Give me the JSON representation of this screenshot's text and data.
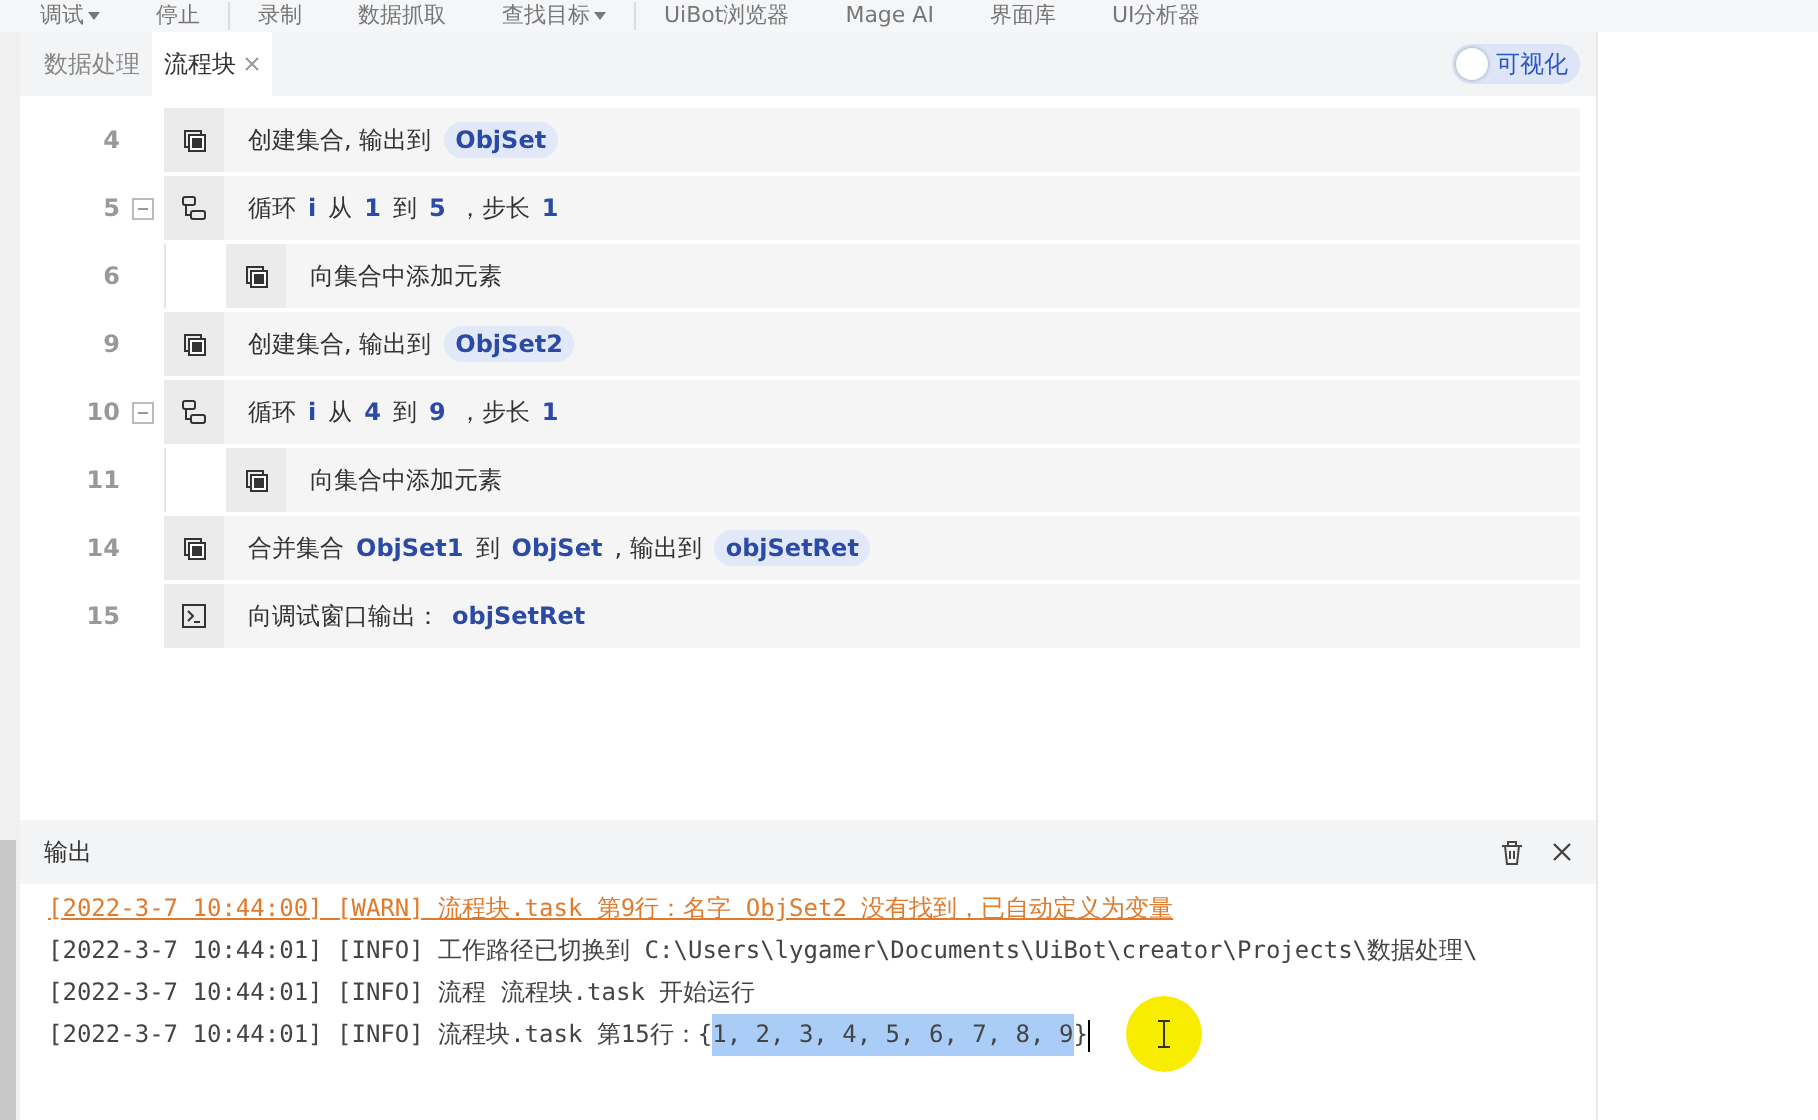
{
  "toolbar": {
    "items": [
      {
        "label": "调试",
        "caret": true
      },
      {
        "label": "停止",
        "caret": false
      },
      {
        "label": "录制",
        "caret": false
      },
      {
        "label": "数据抓取",
        "caret": false
      },
      {
        "label": "查找目标",
        "caret": true
      },
      {
        "label": "UiBot浏览器",
        "caret": false
      },
      {
        "label": "Mage AI",
        "caret": false
      },
      {
        "label": "界面库",
        "caret": false
      },
      {
        "label": "UI分析器",
        "caret": false
      }
    ]
  },
  "tabs": [
    {
      "label": "数据处理",
      "selected": false,
      "closable": false
    },
    {
      "label": "流程块",
      "selected": true,
      "closable": true
    }
  ],
  "visual_toggle": {
    "label": "可视化",
    "on": false
  },
  "blocks": [
    {
      "line": "4",
      "kind": "action",
      "parts": [
        {
          "kind": "text",
          "text": "创建集合, 输出到"
        },
        {
          "kind": "pill",
          "text": "ObjSet"
        }
      ]
    },
    {
      "line": "5",
      "kind": "loop",
      "expanded": true,
      "parts": [
        {
          "kind": "text",
          "text": "循环"
        },
        {
          "kind": "var",
          "text": "i"
        },
        {
          "kind": "text",
          "text": "从"
        },
        {
          "kind": "var",
          "text": "1"
        },
        {
          "kind": "text",
          "text": "到"
        },
        {
          "kind": "var",
          "text": "5"
        },
        {
          "kind": "text",
          "text": "，步长"
        },
        {
          "kind": "var",
          "text": "1"
        }
      ],
      "children": [
        {
          "line": "6",
          "kind": "action",
          "parts": [
            {
              "kind": "text",
              "text": "向集合中添加元素"
            }
          ]
        }
      ]
    },
    {
      "line": "9",
      "kind": "action",
      "parts": [
        {
          "kind": "text",
          "text": "创建集合, 输出到"
        },
        {
          "kind": "pill",
          "text": "ObjSet2"
        }
      ]
    },
    {
      "line": "10",
      "kind": "loop",
      "expanded": true,
      "parts": [
        {
          "kind": "text",
          "text": "循环"
        },
        {
          "kind": "var",
          "text": "i"
        },
        {
          "kind": "text",
          "text": "从"
        },
        {
          "kind": "var",
          "text": "4"
        },
        {
          "kind": "text",
          "text": "到"
        },
        {
          "kind": "var",
          "text": "9"
        },
        {
          "kind": "text",
          "text": "，步长"
        },
        {
          "kind": "var",
          "text": "1"
        }
      ],
      "children": [
        {
          "line": "11",
          "kind": "action",
          "parts": [
            {
              "kind": "text",
              "text": "向集合中添加元素"
            }
          ]
        }
      ]
    },
    {
      "line": "14",
      "kind": "action",
      "parts": [
        {
          "kind": "text",
          "text": "合并集合"
        },
        {
          "kind": "var",
          "text": "ObjSet1"
        },
        {
          "kind": "text",
          "text": "到"
        },
        {
          "kind": "var",
          "text": "ObjSet"
        },
        {
          "kind": "text",
          "text": ", 输出到"
        },
        {
          "kind": "pill",
          "text": "objSetRet"
        }
      ]
    },
    {
      "line": "15",
      "kind": "print",
      "parts": [
        {
          "kind": "text",
          "text": "向调试窗口输出："
        },
        {
          "kind": "var",
          "text": "objSetRet"
        }
      ]
    }
  ],
  "output": {
    "title": "输出",
    "lines": [
      {
        "kind": "warn",
        "text": "[2022-3-7 10:44:00] [WARN] 流程块.task 第9行：名字 ObjSet2 没有找到，已自动定义为变量"
      },
      {
        "kind": "info",
        "text": "[2022-3-7 10:44:01] [INFO] 工作路径已切换到 C:\\Users\\lygamer\\Documents\\UiBot\\creator\\Projects\\数据处理\\"
      },
      {
        "kind": "info",
        "text": "[2022-3-7 10:44:01] [INFO] 流程 流程块.task 开始运行"
      },
      {
        "kind": "info",
        "text": "[2022-3-7 10:44:01] [INFO] 流程块.task 第15行：{",
        "selection": "1, 2, 3, 4, 5, 6, 7, 8, 9",
        "after": "}"
      }
    ]
  }
}
